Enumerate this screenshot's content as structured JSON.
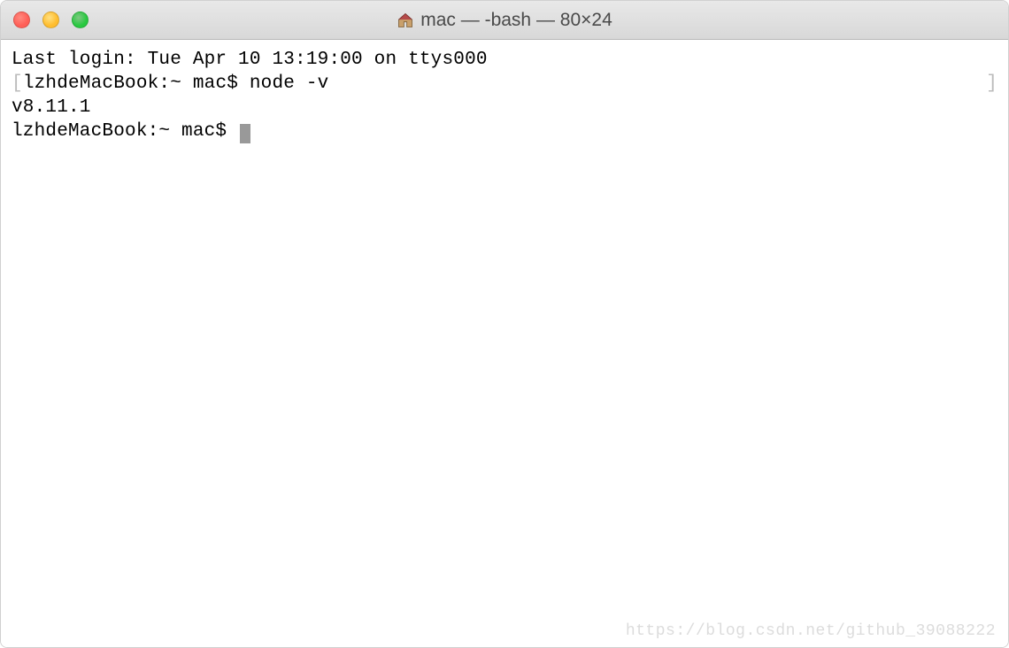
{
  "window": {
    "title": "mac — -bash — 80×24"
  },
  "terminal": {
    "last_login": "Last login: Tue Apr 10 13:19:00 on ttys000",
    "prompt1_prefix": "lzhdeMacBook:~ mac$ ",
    "command1": "node -v",
    "output1": "v8.11.1",
    "prompt2": "lzhdeMacBook:~ mac$ ",
    "bracket_left": "[",
    "bracket_right": "]"
  },
  "watermark": "https://blog.csdn.net/github_39088222"
}
